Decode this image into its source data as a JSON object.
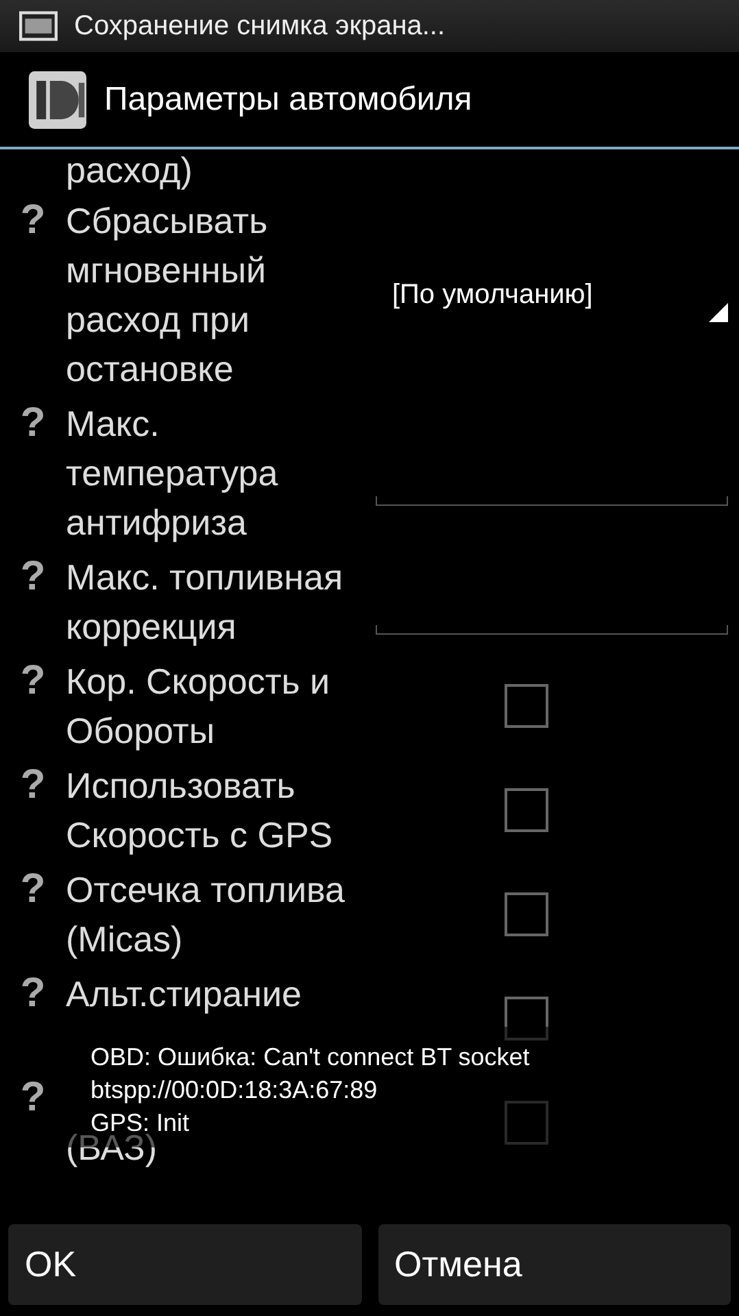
{
  "status_bar": {
    "notification": "Сохранение снимка экрана..."
  },
  "title_bar": {
    "title": "Параметры автомобиля"
  },
  "settings": [
    {
      "kind": "continuation",
      "label": "расход)"
    },
    {
      "kind": "dropdown",
      "help": "?",
      "label": "Сбрасывать мгновенный расход при остановке",
      "value": "[По умолчанию]"
    },
    {
      "kind": "field",
      "help": "?",
      "label": "Макс. температура антифриза"
    },
    {
      "kind": "field",
      "help": "?",
      "label": "Макс. топливная коррекция"
    },
    {
      "kind": "checkbox",
      "help": "?",
      "label": "Кор. Скорость и Обороты",
      "checked": false
    },
    {
      "kind": "checkbox",
      "help": "?",
      "label": "Использовать Скорость с GPS",
      "checked": false
    },
    {
      "kind": "checkbox",
      "help": "?",
      "label": "Отсечка топлива (Micas)",
      "checked": false
    },
    {
      "kind": "checkbox",
      "help": "?",
      "label": "Альт.стирание",
      "checked": false
    },
    {
      "kind": "covered-checkbox",
      "help": "?",
      "label": "(ВАЗ)",
      "checked": false
    }
  ],
  "toast": {
    "lines": [
      "OBD: Ошибка: Can't connect BT socket",
      "btspp://00:0D:18:3A:67:89",
      "GPS: Init"
    ]
  },
  "buttons": [
    {
      "label": "OK"
    },
    {
      "label": "Отмена"
    }
  ]
}
